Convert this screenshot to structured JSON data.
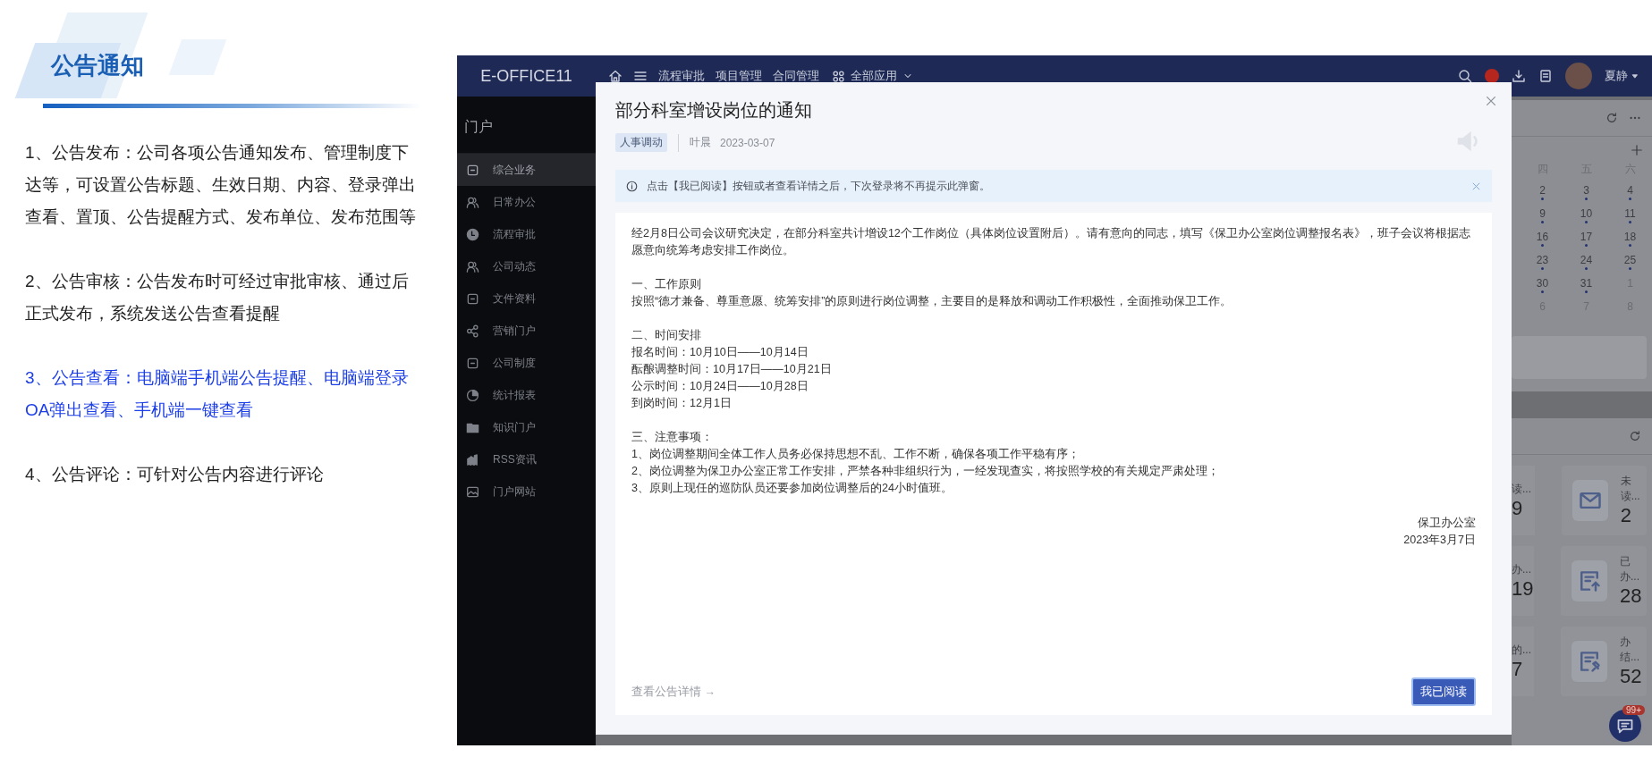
{
  "slide": {
    "title": "公告通知",
    "points": [
      {
        "text": "1、公告发布：公司各项公告通知发布、管理制度下达等，可设置公告标题、生效日期、内容、登录弹出查看、置顶、公告提醒方式、发布单位、发布范围等",
        "highlighted": false
      },
      {
        "text": "2、公告审核：公告发布时可经过审批审核、通过后正式发布，系统发送公告查看提醒",
        "highlighted": false
      },
      {
        "text": "3、公告查看：电脑端手机端公告提醒、电脑端登录OA弹出查看、手机端一键查看",
        "highlighted": true
      },
      {
        "text": "4、公告评论：可针对公告内容进行评论",
        "highlighted": false
      }
    ]
  },
  "app": {
    "header": {
      "brand": "E-OFFICE11",
      "nav": [
        "流程审批",
        "项目管理",
        "合同管理"
      ],
      "apps_menu": "全部应用",
      "user": "夏静"
    },
    "sidebar": {
      "title": "门户",
      "items": [
        {
          "label": "综合业务",
          "selected": true
        },
        {
          "label": "日常办公",
          "selected": false
        },
        {
          "label": "流程审批",
          "selected": false
        },
        {
          "label": "公司动态",
          "selected": false
        },
        {
          "label": "文件资料",
          "selected": false
        },
        {
          "label": "营销门户",
          "selected": false
        },
        {
          "label": "公司制度",
          "selected": false
        },
        {
          "label": "统计报表",
          "selected": false
        },
        {
          "label": "知识门户",
          "selected": false
        },
        {
          "label": "RSS资讯",
          "selected": false
        },
        {
          "label": "门户网站",
          "selected": false
        }
      ]
    },
    "calendar": {
      "weekdays": [
        "四",
        "五",
        "六"
      ],
      "weeks": [
        [
          {
            "day": "2",
            "dot": true,
            "muted": false
          },
          {
            "day": "3",
            "dot": true,
            "muted": false
          },
          {
            "day": "4",
            "dot": true,
            "muted": false
          }
        ],
        [
          {
            "day": "9",
            "dot": true,
            "muted": false
          },
          {
            "day": "10",
            "dot": true,
            "muted": false
          },
          {
            "day": "11",
            "dot": true,
            "muted": false
          }
        ],
        [
          {
            "day": "16",
            "dot": true,
            "muted": false
          },
          {
            "day": "17",
            "dot": true,
            "muted": false
          },
          {
            "day": "18",
            "dot": true,
            "muted": false
          }
        ],
        [
          {
            "day": "23",
            "dot": true,
            "muted": false
          },
          {
            "day": "24",
            "dot": true,
            "muted": false
          },
          {
            "day": "25",
            "dot": true,
            "muted": false
          }
        ],
        [
          {
            "day": "30",
            "dot": true,
            "muted": false
          },
          {
            "day": "31",
            "dot": true,
            "muted": false
          },
          {
            "day": "1",
            "dot": false,
            "muted": true
          }
        ],
        [
          {
            "day": "6",
            "dot": false,
            "muted": true
          },
          {
            "day": "7",
            "dot": false,
            "muted": true
          },
          {
            "day": "8",
            "dot": false,
            "muted": true
          }
        ]
      ]
    },
    "stats": [
      {
        "partial_label": "读...",
        "partial_value": "9",
        "label": "未读...",
        "value": "2"
      },
      {
        "partial_label": "办...",
        "partial_value": "19",
        "label": "已办...",
        "value": "28"
      },
      {
        "partial_label": "的...",
        "partial_value": "7",
        "label": "办结...",
        "value": "52"
      }
    ],
    "chat_badge": "99+",
    "modal": {
      "title": "部分科室增设岗位的通知",
      "tag": "人事调动",
      "author": "叶晨",
      "date": "2023-03-07",
      "notice": "点击【我已阅读】按钮或者查看详情之后，下次登录将不再提示此弹窗。",
      "sections": [
        [
          "经2月8日公司会议研究决定，在部分科室共计增设12个工作岗位（具体岗位设置附后）。请有意向的同志，填写《保卫办公室岗位调整报名表》，班子会议将根据志愿意向统筹考虑安排工作岗位。"
        ],
        [
          "一、工作原则",
          "按照“德才兼备、尊重意愿、统筹安排”的原则进行岗位调整，主要目的是释放和调动工作积极性，全面推动保卫工作。"
        ],
        [
          "二、时间安排",
          "报名时间：10月10日——10月14日",
          "酝酿调整时间：10月17日——10月21日",
          "公示时间：10月24日——10月28日",
          "到岗时间：12月1日"
        ],
        [
          "三、注意事项：",
          "1、岗位调整期间全体工作人员务必保持思想不乱、工作不断，确保各项工作平稳有序；",
          "2、岗位调整为保卫办公室正常工作安排，严禁各种非组织行为，一经发现查实，将按照学校的有关规定严肃处理；",
          "3、原则上现任的巡防队员还要参加岗位调整后的24小时值班。"
        ]
      ],
      "signature": [
        "保卫办公室",
        "2023年3月7日"
      ],
      "details_link": "查看公告详情 →",
      "confirm_button": "我已阅读"
    }
  }
}
